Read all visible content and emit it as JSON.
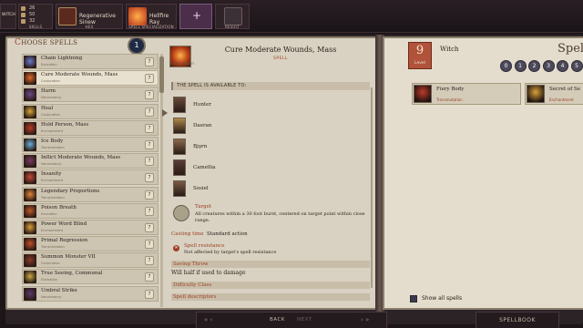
{
  "top_bar": {
    "witch_label": "WITCH",
    "stats": [
      "26",
      "50",
      "32"
    ],
    "skills_label": "SKILLS",
    "feat1_name": "Regenerative Sinew",
    "feat1_badge": "HEX",
    "feat2_name": "Hellfire Ray",
    "feat2_badge": "SPELL SPECIALIZATION",
    "add_label": "+",
    "result_label": "RESULT"
  },
  "spell_list": {
    "header_cap": "C",
    "header_rest": "HOOSE SPELLS",
    "remaining": "1",
    "items": [
      {
        "name": "Chain Lightning",
        "school": "Evocation",
        "level": "7",
        "color": "#6a7bd0"
      },
      {
        "name": "Cure Moderate Wounds, Mass",
        "school": "Conjuration",
        "level": "7",
        "color": "#e06a2a"
      },
      {
        "name": "Harm",
        "school": "Necromancy",
        "level": "7",
        "color": "#6b4a8a"
      },
      {
        "name": "Heal",
        "school": "Conjuration",
        "level": "7",
        "color": "#d8a83c"
      },
      {
        "name": "Hold Person, Mass",
        "school": "Enchantment",
        "level": "7",
        "color": "#b83c2a"
      },
      {
        "name": "Ice Body",
        "school": "Transmutation",
        "level": "7",
        "color": "#6ab0d8"
      },
      {
        "name": "Inflict Moderate Wounds, Mass",
        "school": "Necromancy",
        "level": "7",
        "color": "#7a3a62"
      },
      {
        "name": "Insanity",
        "school": "Enchantment",
        "level": "7",
        "color": "#c44a3c"
      },
      {
        "name": "Legendary Proportions",
        "school": "Transmutation",
        "level": "7",
        "color": "#e0883c"
      },
      {
        "name": "Poison Breath",
        "school": "Evocation",
        "level": "7",
        "color": "#c05a2a"
      },
      {
        "name": "Power Word Blind",
        "school": "Enchantment",
        "level": "7",
        "color": "#d8a03a"
      },
      {
        "name": "Primal Regression",
        "school": "Transmutation",
        "level": "7",
        "color": "#c0502a"
      },
      {
        "name": "Summon Monster VII",
        "school": "Conjuration",
        "level": "7",
        "color": "#8a3a2a"
      },
      {
        "name": "True Seeing, Communal",
        "school": "Divination",
        "level": "7",
        "color": "#c8a84a"
      },
      {
        "name": "Umbral Strike",
        "school": "Necromancy",
        "level": "7",
        "color": "#5a3a6a"
      }
    ]
  },
  "detail": {
    "title": "Cure Moderate Wounds, Mass",
    "kind": "SPELL",
    "school": "Conjuration",
    "available_header": "THE SPELL IS AVAILABLE TO:",
    "characters": [
      {
        "name": "Hunter",
        "color": "#6a4a3a"
      },
      {
        "name": "Daeran",
        "color": "#b0894a"
      },
      {
        "name": "Bjǫrn",
        "color": "#8a6a4a"
      },
      {
        "name": "Camellia",
        "color": "#5a3a36"
      },
      {
        "name": "Sosiel",
        "color": "#7a5a44"
      }
    ],
    "target_title": "Target",
    "target_text": "All creatures within a 30 foot burst, centered on target point within close range.",
    "casting_label": "Casting time",
    "casting_value": "Standard action",
    "resistance_icon": "✕",
    "resistance_title": "Spell resistance",
    "resistance_text": "Not affected by target's spell resistance",
    "saving_throw_head": "Saving Throw",
    "saving_throw_text": "Will half if used to damage",
    "difficulty_head": "Difficulty Class",
    "descriptor_head": "Spell descriptors"
  },
  "spellbook": {
    "level_num": "9",
    "level_word": "Level",
    "class_name": "Witch",
    "title_partial": "Spell",
    "level_tabs": [
      "0",
      "1",
      "2",
      "3",
      "4",
      "5"
    ],
    "known": [
      {
        "name": "Fiery Body",
        "school": "Transmutation",
        "color": "#c03a2a"
      },
      {
        "name": "Secret of Se",
        "school": "Enchantment",
        "color": "#d8a03a"
      }
    ],
    "show_all_label": "Show all spells"
  },
  "bottom": {
    "back_label": "BACK",
    "next_label": "NEXT",
    "left_arrows": "« ‹",
    "right_arrows": "› »",
    "spellbook_label": "SPELLBOOK"
  },
  "colors": {
    "accent": "#9c3d24",
    "parchment": "#d9d2c2",
    "frame": "#1c1618"
  }
}
